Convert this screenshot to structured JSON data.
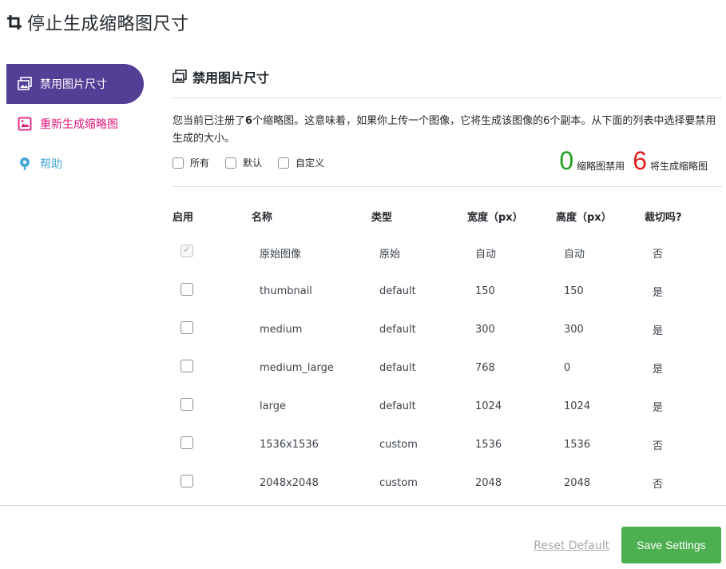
{
  "page": {
    "title": "停止生成缩略图尺寸",
    "icon": "crop-icon"
  },
  "sidebar": {
    "items": [
      {
        "label": "禁用图片尺寸",
        "icon": "images-icon",
        "active": true
      },
      {
        "label": "重新生成缩略图",
        "icon": "image-regenerate-icon",
        "active": false
      },
      {
        "label": "帮助",
        "icon": "help-lifebuoy-icon",
        "active": false
      }
    ]
  },
  "section": {
    "title": "禁用图片尺寸",
    "icon": "images-icon",
    "desc_prefix": "您当前已注册了",
    "desc_count": "6",
    "desc_suffix": "个缩略图。这意味着，如果你上传一个图像，它将生成该图像的6个副本。从下面的列表中选择要禁用生成的大小。"
  },
  "filters": {
    "all": "所有",
    "default": "默认",
    "custom": "自定义"
  },
  "counts": {
    "disabled_value": "0",
    "disabled_label": "缩略图禁用",
    "generated_value": "6",
    "generated_label": "将生成缩略图",
    "disabled_color": "#20a020",
    "generated_color": "#e02020"
  },
  "table": {
    "headers": [
      "启用",
      "名称",
      "类型",
      "宽度（px）",
      "高度（px）",
      "裁切吗?"
    ],
    "rows": [
      {
        "checked": true,
        "disabled": true,
        "name": "原始图像",
        "type": "原始",
        "width": "自动",
        "height": "自动",
        "crop": "否"
      },
      {
        "checked": false,
        "name": "thumbnail",
        "type": "default",
        "width": "150",
        "height": "150",
        "crop": "是"
      },
      {
        "checked": false,
        "name": "medium",
        "type": "default",
        "width": "300",
        "height": "300",
        "crop": "是"
      },
      {
        "checked": false,
        "name": "medium_large",
        "type": "default",
        "width": "768",
        "height": "0",
        "crop": "是"
      },
      {
        "checked": false,
        "name": "large",
        "type": "default",
        "width": "1024",
        "height": "1024",
        "crop": "是"
      },
      {
        "checked": false,
        "name": "1536x1536",
        "type": "custom",
        "width": "1536",
        "height": "1536",
        "crop": "否"
      },
      {
        "checked": false,
        "name": "2048x2048",
        "type": "custom",
        "width": "2048",
        "height": "2048",
        "crop": "否"
      }
    ]
  },
  "footer": {
    "reset_label": "Reset Default",
    "save_label": "Save Settings",
    "save_color": "#4caf50"
  },
  "colors": {
    "accent": "#523f96",
    "regen": "#e2187d",
    "help": "#4aa8d6"
  }
}
